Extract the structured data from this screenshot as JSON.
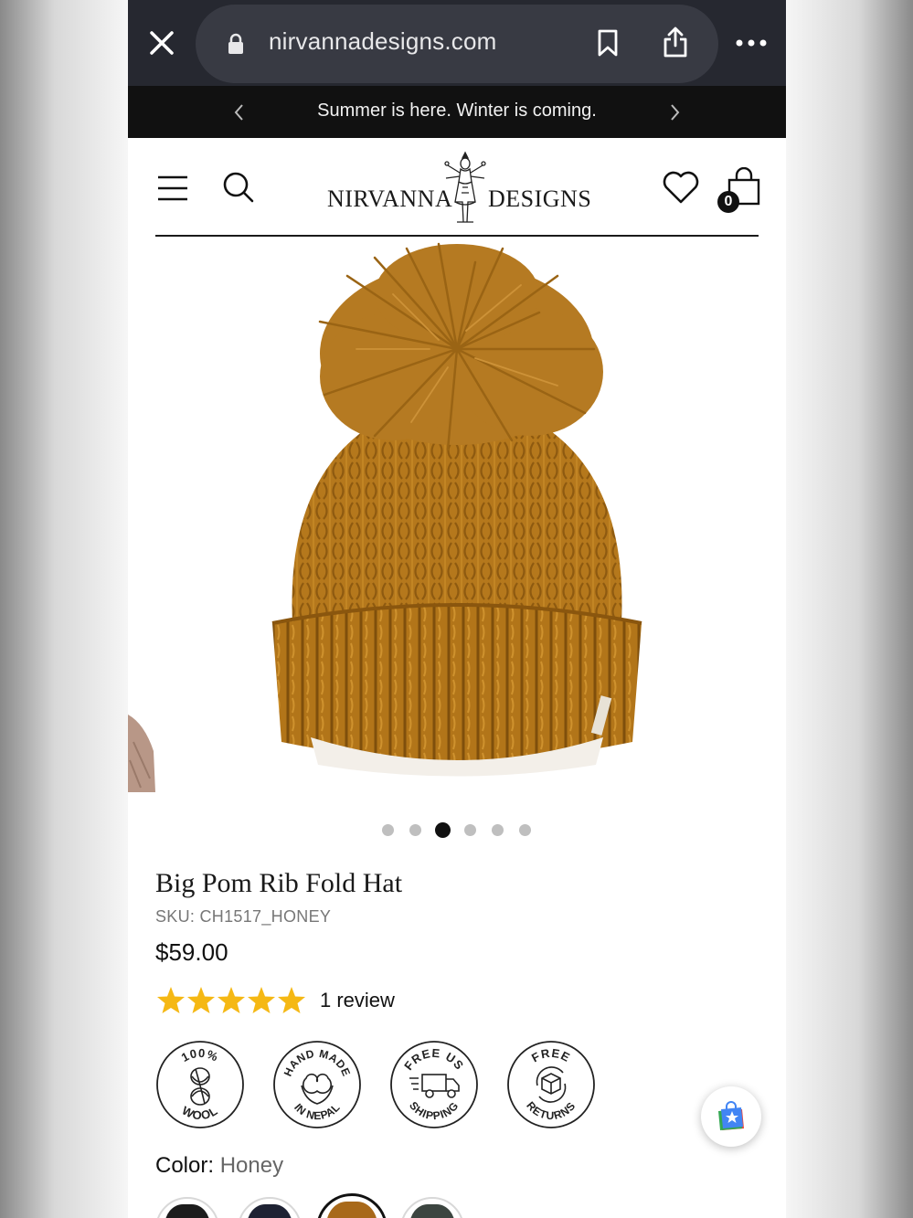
{
  "browser": {
    "url": "nirvannadesigns.com"
  },
  "announcement": {
    "text": "Summer is here. Winter is coming."
  },
  "header": {
    "logo_left": "NIRVANNA",
    "logo_right": "DESIGNS",
    "cart_count": "0"
  },
  "gallery": {
    "slide_count": 6,
    "active_slide": 3
  },
  "product": {
    "title": "Big Pom Rib Fold Hat",
    "sku": "SKU: CH1517_HONEY",
    "price": "$59.00",
    "rating": 5,
    "review_text": "1 review",
    "color_label": "Color:",
    "color_value": "Honey"
  },
  "badges": [
    {
      "name": "100-percent-wool",
      "top": "100%",
      "bottom": "WOOL"
    },
    {
      "name": "hand-made-in-nepal",
      "top": "HAND MADE",
      "bottom": "IN NEPAL"
    },
    {
      "name": "free-us-shipping",
      "top": "FREE US",
      "bottom": "SHIPPING"
    },
    {
      "name": "free-returns",
      "top": "FREE",
      "bottom": "RETURNS"
    }
  ],
  "colors": {
    "accent_star": "#f5b814",
    "hat_honey": "#b87a1c",
    "swatches": [
      "#1c1c1c",
      "#1e2233",
      "#a8691a",
      "#3c4540"
    ]
  }
}
